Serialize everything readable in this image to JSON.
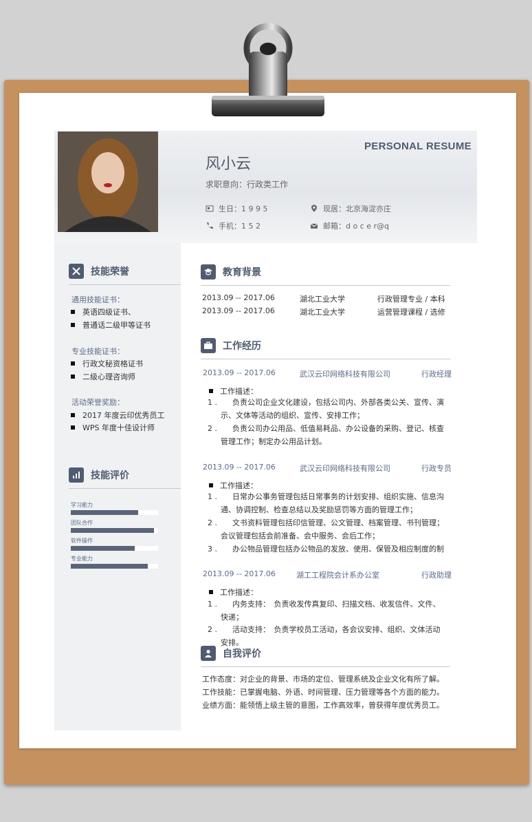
{
  "header": {
    "title": "PERSONAL RESUME",
    "name": "风小云",
    "objective": "求职意向：行政类工作",
    "birth": "生日：1 9 9 5",
    "phone": "手机：1 5 2",
    "location": "现居：北京海淀亦庄",
    "email": "邮箱：d o c e r@q"
  },
  "sidebar": {
    "honors_title": "技能荣誉",
    "groups": [
      {
        "label": "通用技能证书：",
        "items": [
          "英语四级证书、",
          "普通话二级甲等证书"
        ]
      },
      {
        "label": "专业技能证书：",
        "items": [
          "行政文秘资格证书",
          "二级心理咨询师"
        ]
      },
      {
        "label": "活动荣誉奖励：",
        "items": [
          "2017 年度云印优秀员工",
          "WPS 年度十佳设计师"
        ]
      }
    ],
    "skills_title": "技能评价",
    "skills": [
      {
        "name": "学习能力",
        "level": 0.77
      },
      {
        "name": "团队合作",
        "level": 0.95
      },
      {
        "name": "软件操作",
        "level": 0.73
      },
      {
        "name": "专业能力",
        "level": 0.88
      }
    ]
  },
  "education": {
    "title": "教育背景",
    "rows": [
      {
        "period": "2013.09 -- 2017.06",
        "school": "湖北工业大学",
        "major": "行政管理专业 / 本科"
      },
      {
        "period": "2013.09 -- 2017.06",
        "school": "湖北工业大学",
        "major": "运营管理课程 / 选修"
      }
    ]
  },
  "work": {
    "title": "工作经历",
    "desc_label": "工作描述：",
    "jobs": [
      {
        "period": "2013.09 -- 2017.06",
        "company": "武汉云印网络科技有限公司",
        "role": "行政经理",
        "items": [
          {
            "n": "1 .",
            "lines": [
              "负责公司企业文化建设，包括公司内、外部各类公关、宣传、演",
              "示、文体等活动的组织、宣传、安排工作；"
            ]
          },
          {
            "n": "2 .",
            "lines": [
              "负责公司办公用品、低值易耗品、办公设备的采购、登记、核查",
              "管理工作；制定办公用品计划。"
            ]
          }
        ]
      },
      {
        "period": "2013.09 -- 2017.06",
        "company": "武汉云印网络科技有限公司",
        "role": "行政专员",
        "items": [
          {
            "n": "1 .",
            "lines": [
              "日常办公事务管理包括日常事务的计划安排、组织实施、信息沟",
              "通、协调控制、检查总结以及奖励惩罚等方面的管理工作；"
            ]
          },
          {
            "n": "2 .",
            "lines": [
              "文书资料管理包括印信管理、公文管理、档案管理、书刊管理；",
              "会议管理包括会前准备、会中服务、会后工作；"
            ]
          },
          {
            "n": "3 .",
            "lines": [
              "办公物品管理包括办公物品的发放、使用、保管及相应制度的制"
            ]
          }
        ]
      },
      {
        "period": "2013.09 -- 2017.06",
        "company": "湖工工程院会计系办公室",
        "role": "行政助理",
        "items": [
          {
            "n": "1 .",
            "lines": [
              "内务支持：　负责收发传真复印、扫描文档、收发信件、文件、",
              "快递；"
            ]
          },
          {
            "n": "2 .",
            "lines": [
              "活动支持：　负责学校员工活动，各会议安排、组织、文体活动",
              "安排。"
            ]
          }
        ]
      }
    ]
  },
  "self": {
    "title": "自我评价",
    "lines": [
      "工作态度：对企业的背景、市场的定位、管理系统及企业文化有所了解。",
      "工作技能：已掌握电脑、外语、时间管理、压力管理等各个方面的能力。",
      "业绩方面：能领悟上级主管的意图，工作高效率，曾获得年度优秀员工。"
    ]
  },
  "colors": {
    "accent": "#4f5b70",
    "board": "#c4915f",
    "bar": "#5a6479"
  }
}
